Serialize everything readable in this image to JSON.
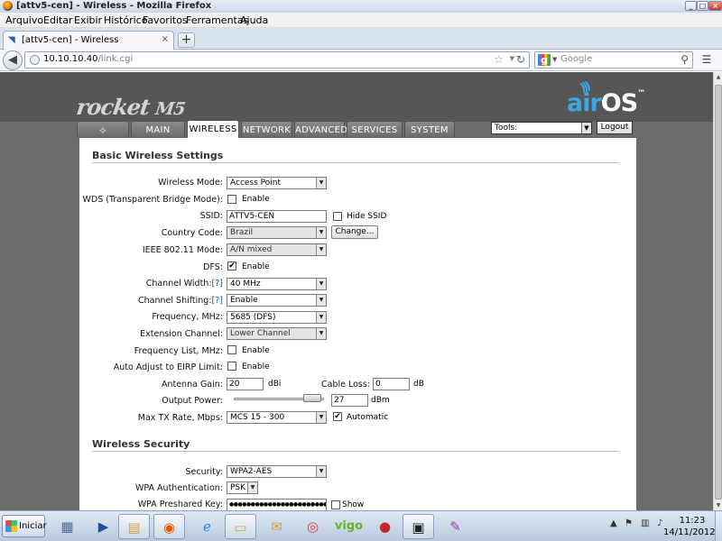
{
  "window": {
    "title": "[attv5-cen] - Wireless - Mozilla Firefox",
    "controls": {
      "minimize": "_",
      "maximize": "□",
      "close": "×"
    }
  },
  "menubar": {
    "items": [
      "Arquivo",
      "Editar",
      "Exibir",
      "Histórico",
      "Favoritos",
      "Ferramentas",
      "Ajuda"
    ],
    "mnemonics": [
      "A",
      "E",
      "x",
      "H",
      "F",
      "F",
      "u"
    ]
  },
  "browser_tabs": [
    {
      "label": "[attv5-cen] - Wireless",
      "close": "×"
    }
  ],
  "new_tab": "+",
  "navigation": {
    "back_icon": "back-arrow-icon",
    "url_host": "10.10.10.40",
    "url_path": "/link.cgi",
    "search_placeholder": "Google",
    "search_engine_icon": "google-icon"
  },
  "header": {
    "product": "rocket M5",
    "product_main": "rocket",
    "product_model": "M5",
    "brand_air": "air",
    "brand_os": "OS",
    "brand_tm": "™"
  },
  "nav_tabs": {
    "logo": "ubiquiti-logo-icon",
    "items": [
      "MAIN",
      "WIRELESS",
      "NETWORK",
      "ADVANCED",
      "SERVICES",
      "SYSTEM"
    ],
    "active": "WIRELESS"
  },
  "tools": {
    "value": "Tools:",
    "logout_label": "Logout"
  },
  "basic_wireless": {
    "section_title": "Basic Wireless Settings",
    "wireless_mode": {
      "label": "Wireless Mode:",
      "value": "Access Point"
    },
    "wds": {
      "label": "WDS (Transparent Bridge Mode):",
      "checkbox_label": "Enable",
      "checked": false
    },
    "ssid": {
      "label": "SSID:",
      "value": "ATTV5-CEN",
      "hide_label": "Hide SSID",
      "hide_checked": false
    },
    "country_code": {
      "label": "Country Code:",
      "value": "Brazil",
      "change_label": "Change..."
    },
    "ieee_mode": {
      "label": "IEEE 802.11 Mode:",
      "value": "A/N mixed"
    },
    "dfs": {
      "label": "DFS:",
      "checkbox_label": "Enable",
      "checked": true
    },
    "channel_width": {
      "label": "Channel Width:",
      "help": "[?]",
      "value": "40 MHz"
    },
    "channel_shifting": {
      "label": "Channel Shifting:",
      "help": "[?]",
      "value": "Enable"
    },
    "frequency": {
      "label": "Frequency, MHz:",
      "value": "5685 (DFS)"
    },
    "extension_channel": {
      "label": "Extension Channel:",
      "value": "Lower Channel"
    },
    "frequency_list": {
      "label": "Frequency List, MHz:",
      "checkbox_label": "Enable",
      "checked": false
    },
    "auto_adjust": {
      "label": "Auto Adjust to EIRP Limit:",
      "checkbox_label": "Enable",
      "checked": false
    },
    "antenna_gain": {
      "label": "Antenna Gain:",
      "value": "20",
      "unit": "dBi"
    },
    "cable_loss": {
      "label": "Cable Loss:",
      "value": "0",
      "unit": "dB"
    },
    "output_power": {
      "label": "Output Power:",
      "value": "27",
      "unit": "dBm",
      "slider_fraction": 0.95
    },
    "max_tx_rate": {
      "label": "Max TX Rate, Mbps:",
      "value": "MCS 15 - 300",
      "automatic_label": "Automatic",
      "automatic_checked": true
    }
  },
  "wireless_security": {
    "section_title": "Wireless Security",
    "security": {
      "label": "Security:",
      "value": "WPA2-AES"
    },
    "wpa_auth": {
      "label": "WPA Authentication:",
      "value": "PSK"
    },
    "wpa_key": {
      "label": "WPA Preshared Key:",
      "value": "●●●●●●●●●●●●●●●●●●●●●●●●●●●●",
      "show_label": "Show",
      "show_checked": false
    }
  },
  "taskbar": {
    "start_label": "Iniciar",
    "apps": [
      {
        "icon": "network-folder-icon",
        "running": false
      },
      {
        "icon": "powershell-icon",
        "running": false
      },
      {
        "icon": "file-explorer-icon",
        "running": true
      },
      {
        "icon": "firefox-icon",
        "running": true
      },
      {
        "icon": "internet-explorer-icon",
        "running": false
      },
      {
        "icon": "folder-icon",
        "running": true
      },
      {
        "icon": "outlook-icon",
        "running": false
      },
      {
        "icon": "chrome-icon",
        "running": false
      },
      {
        "icon": "vigo-icon",
        "label": "vigo",
        "running": false
      },
      {
        "icon": "red-orb-icon",
        "running": false
      },
      {
        "icon": "command-prompt-icon",
        "running": true
      },
      {
        "icon": "paint-icon",
        "running": false
      }
    ],
    "clock_time": "11:23",
    "clock_date": "14/11/2012"
  }
}
